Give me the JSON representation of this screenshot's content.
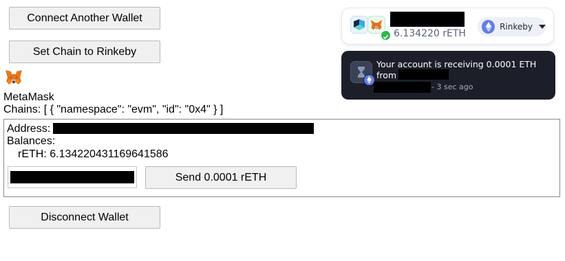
{
  "buttons": {
    "connect_another": "Connect Another Wallet",
    "set_chain": "Set Chain to Rinkeby",
    "disconnect": "Disconnect Wallet",
    "send": "Send 0.0001 rETH"
  },
  "wallet": {
    "label": "MetaMask",
    "chains_line": "Chains: [ { \"namespace\": \"evm\", \"id\": \"0x4\" } ]",
    "address_label": "Address:",
    "balances_label": "Balances:",
    "balance_line": "rETH: 6.134220431169641586"
  },
  "widget": {
    "balance": "6.134220 rETH",
    "chain_name": "Rinkeby"
  },
  "toast": {
    "message_line1": "Your account is receiving 0.0001 ETH",
    "message_line2": "from",
    "time": "3 sec ago"
  },
  "colors": {
    "metamask_orange": "#e2761b",
    "eth_blue": "#627eea",
    "success_green": "#2db84d",
    "toast_bg": "#1c1f2a"
  }
}
